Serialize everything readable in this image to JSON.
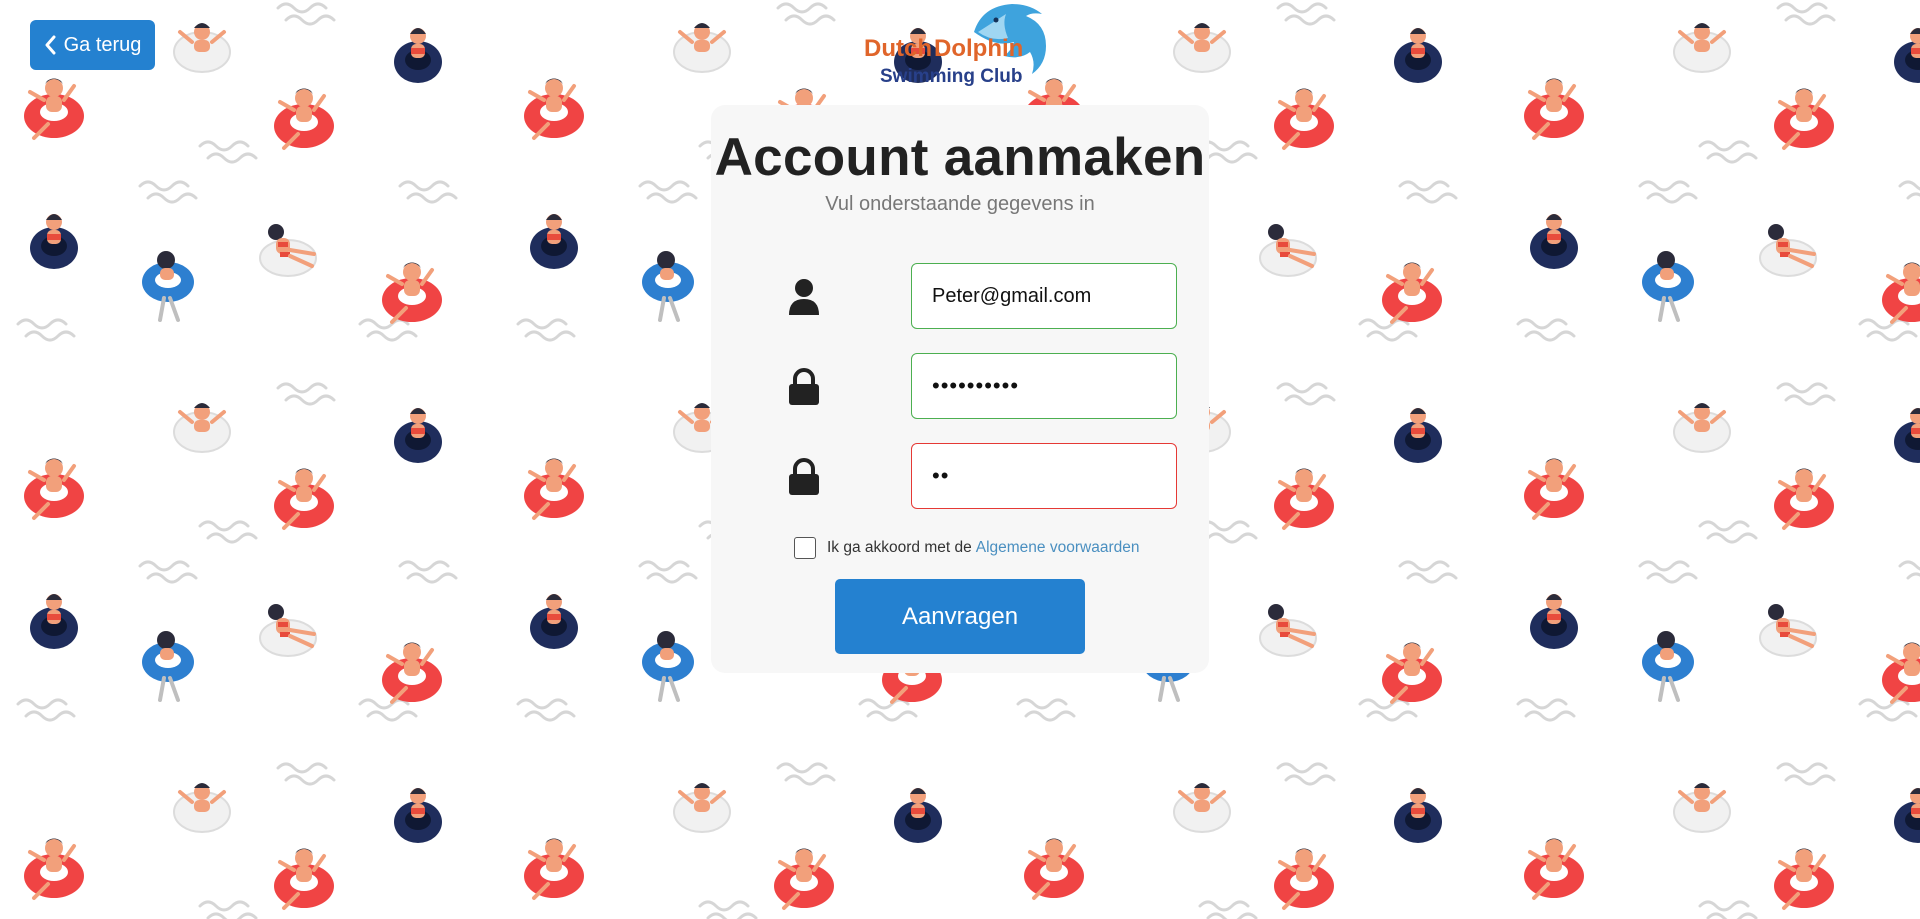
{
  "header": {
    "back_label": "Ga terug",
    "logo": {
      "line1_part1": "Dutch",
      "line1_part2": "Dolphin",
      "line2": "Swimming Club"
    }
  },
  "form": {
    "title": "Account aanmaken",
    "subtitle": "Vul onderstaande gegevens in",
    "email": {
      "value": "Peter@gmail.com",
      "icon": "user-icon",
      "status": "valid"
    },
    "password": {
      "value": "••••••••••",
      "icon": "lock-icon",
      "status": "valid"
    },
    "password_confirm": {
      "value": "••",
      "icon": "lock-icon",
      "status": "invalid"
    },
    "terms": {
      "checked": false,
      "text": "Ik ga akkoord met de",
      "link_text": "Algemene voorwaarden"
    },
    "submit_label": "Aanvragen"
  },
  "colors": {
    "primary": "#2481d0",
    "valid_border": "#4caf50",
    "invalid_border": "#e53935",
    "card_bg": "#f7f7f7",
    "link": "#4a8fc0"
  }
}
